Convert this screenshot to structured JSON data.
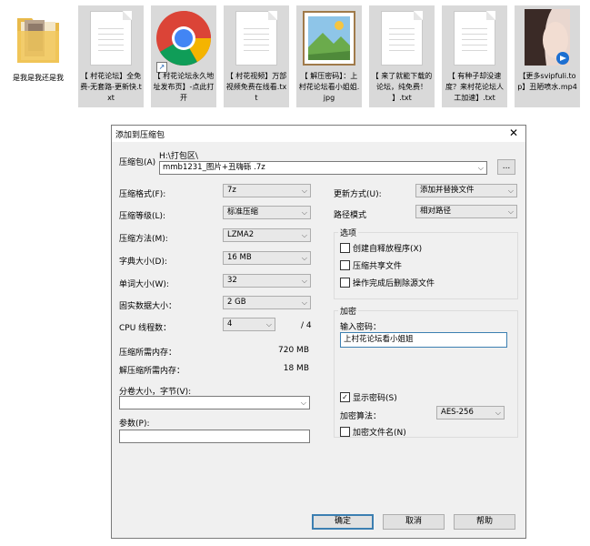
{
  "files": [
    {
      "name": "是我是我还是我",
      "type": "folder"
    },
    {
      "name": "【 村花论坛】全免费-无套路-更新快.txt",
      "type": "txt"
    },
    {
      "name": "【 村花论坛永久地址发布页】-点此打开",
      "type": "chrome-shortcut"
    },
    {
      "name": "【 村花视频】万部视频免费在线看.txt",
      "type": "txt"
    },
    {
      "name": "【 解压密码】：上村花论坛看小姐姐.jpg",
      "type": "image"
    },
    {
      "name": "【 来了就能下载的论坛，纯免费！ 】.txt",
      "type": "txt"
    },
    {
      "name": "【 有种子却没速度？来村花论坛人工加速】.txt",
      "type": "txt"
    },
    {
      "name": "【更多svipfuli.top】丑陋喷水.mp4",
      "type": "video"
    }
  ],
  "dialog": {
    "title": "添加到压缩包",
    "close": "✕",
    "archive_label": "压缩包(A)",
    "archive_path": "H:\\打包区\\",
    "archive_name": "mmb1231_图片+丑嗨砾  .7z",
    "browse": "...",
    "format_label": "压缩格式(F):",
    "format_value": "7z",
    "level_label": "压缩等级(L):",
    "level_value": "标准压缩",
    "method_label": "压缩方法(M):",
    "method_value": "LZMA2",
    "dict_label": "字典大小(D):",
    "dict_value": "16 MB",
    "word_label": "单词大小(W):",
    "word_value": "32",
    "solid_label": "固实数据大小：",
    "solid_value": "2 GB",
    "cpu_label": "CPU 线程数：",
    "cpu_value": "4",
    "cpu_total": "/ 4",
    "mem_comp_label": "压缩所需内存：",
    "mem_comp_value": "720 MB",
    "mem_decomp_label": "解压缩所需内存：",
    "mem_decomp_value": "18 MB",
    "split_label": "分卷大小，字节(V):",
    "split_value": "",
    "params_label": "参数(P):",
    "params_value": "",
    "update_label": "更新方式(U):",
    "update_value": "添加并替换文件",
    "pathmode_label": "路径模式",
    "pathmode_value": "相对路径",
    "options_title": "选项",
    "opt_sfx": "创建自释放程序(X)",
    "opt_shared": "压缩共享文件",
    "opt_delete": "操作完成后删除源文件",
    "enc_title": "加密",
    "pwd_label": "输入密码：",
    "pwd_value": "上村花论坛看小姐姐",
    "show_pwd": "显示密码(S)",
    "enc_method_label": "加密算法：",
    "enc_method_value": "AES-256",
    "enc_names": "加密文件名(N)",
    "ok": "确定",
    "cancel": "取消",
    "help": "帮助"
  }
}
